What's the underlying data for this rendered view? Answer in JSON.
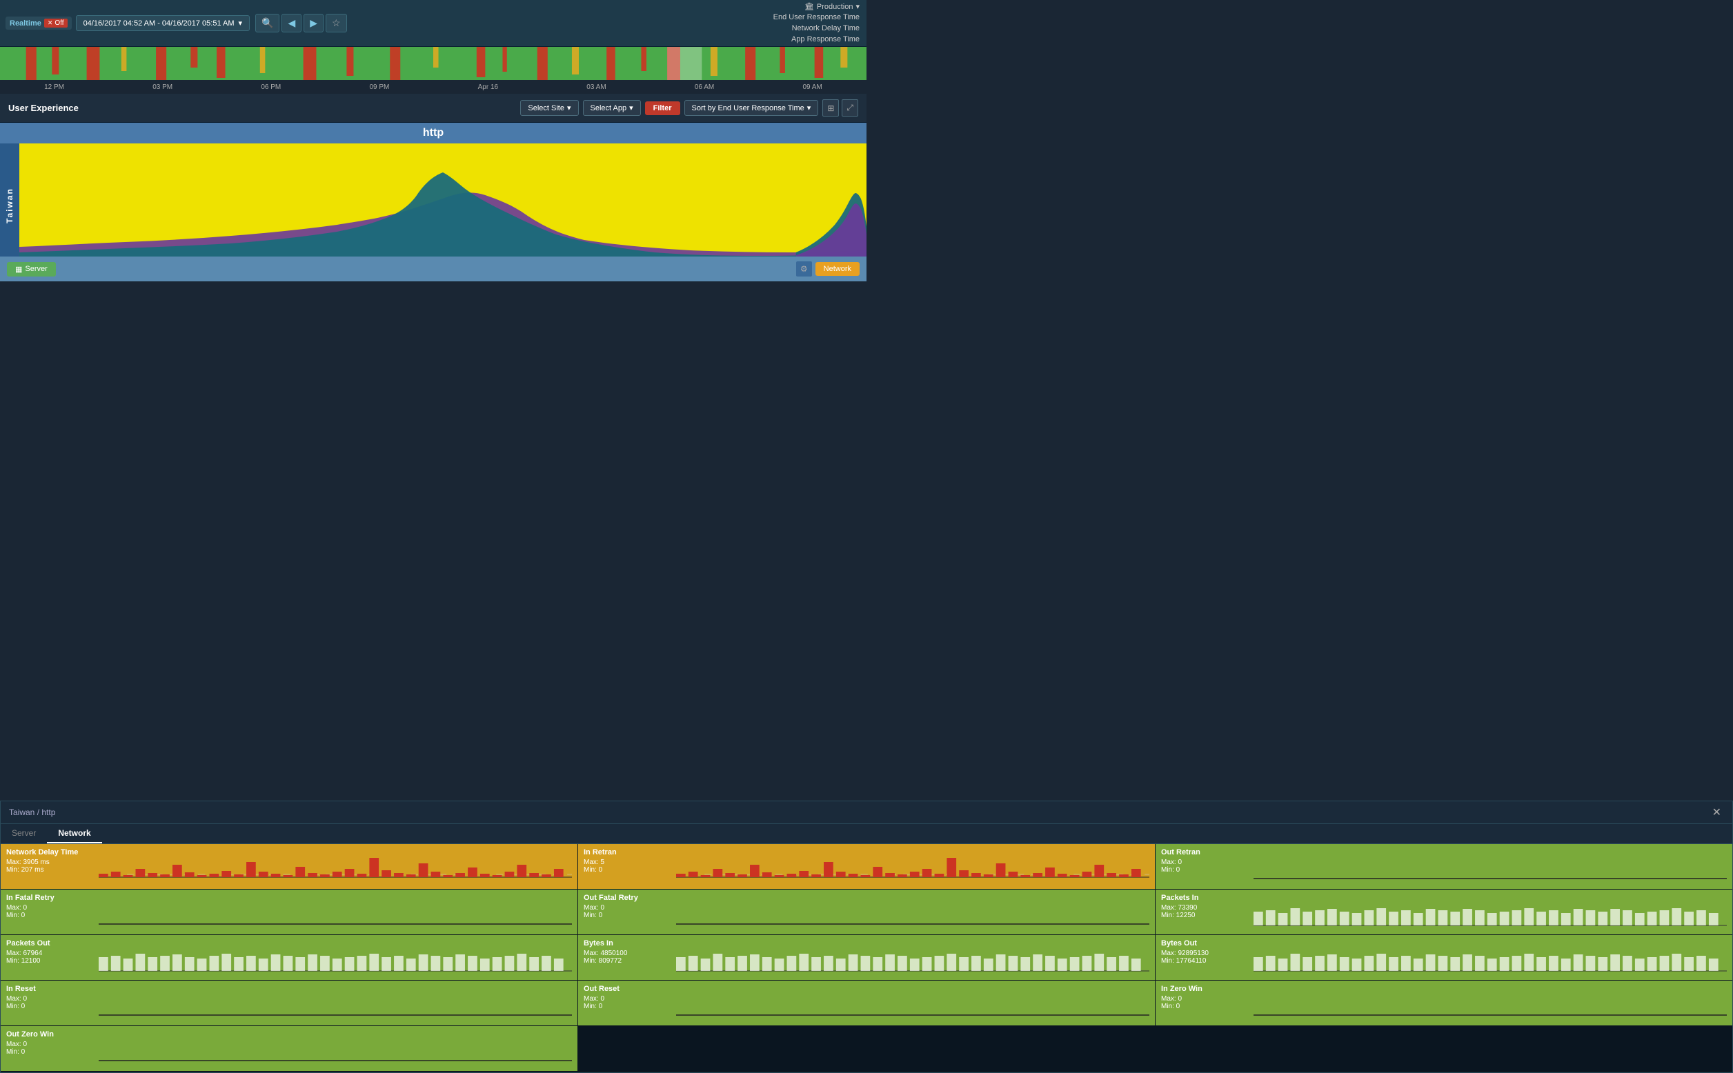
{
  "topbar": {
    "realtime_label": "Realtime",
    "off_label": "Off",
    "time_range": "04/16/2017 04:52 AM - 04/16/2017 05:51 AM",
    "production_label": "Production",
    "legend": {
      "end_user_response_time": "End User Response Time",
      "network_delay_time": "Network Delay Time",
      "app_response_time": "App Response Time"
    }
  },
  "time_labels": [
    "12 PM",
    "03 PM",
    "06 PM",
    "09 PM",
    "Apr 16",
    "03 AM",
    "06 AM",
    "09 AM"
  ],
  "ux": {
    "title": "User Experience",
    "select_site_label": "Select Site",
    "select_app_label": "Select App",
    "filter_label": "Filter",
    "sort_label": "Sort by End User Response Time"
  },
  "chart": {
    "title": "http",
    "site_label": "Taiwan"
  },
  "server_btn_label": "Server",
  "network_btn_label": "Network",
  "detail": {
    "title": "Taiwan / http",
    "tabs": [
      "Server",
      "Network"
    ],
    "active_tab": "Network",
    "metrics": [
      {
        "name": "Network Delay Time",
        "max": "Max: 3905 ms",
        "min": "Min: 207 ms",
        "style": "yellow",
        "has_chart": true,
        "chart_type": "bar_red"
      },
      {
        "name": "In Retran",
        "max": "Max: 5",
        "min": "Min: 0",
        "style": "yellow",
        "has_chart": true,
        "chart_type": "bar_red"
      },
      {
        "name": "Out Retran",
        "max": "Max: 0",
        "min": "Min: 0",
        "style": "green",
        "has_chart": false
      },
      {
        "name": "In Fatal Retry",
        "max": "Max: 0",
        "min": "Min: 0",
        "style": "green",
        "has_chart": false
      },
      {
        "name": "Out Fatal Retry",
        "max": "Max: 0",
        "min": "Min: 0",
        "style": "green",
        "has_chart": false
      },
      {
        "name": "Packets In",
        "max": "Max: 73390",
        "min": "Min: 12250",
        "style": "green",
        "has_chart": true,
        "chart_type": "bar_white"
      },
      {
        "name": "Packets Out",
        "max": "Max: 67964",
        "min": "Min: 12100",
        "style": "green",
        "has_chart": true,
        "chart_type": "bar_white"
      },
      {
        "name": "Bytes In",
        "max": "Max: 4850100",
        "min": "Min: 809772",
        "style": "green",
        "has_chart": true,
        "chart_type": "bar_white"
      },
      {
        "name": "Bytes Out",
        "max": "Max: 92895130",
        "min": "Min: 17764110",
        "style": "green",
        "has_chart": true,
        "chart_type": "bar_white"
      },
      {
        "name": "In Reset",
        "max": "Max: 0",
        "min": "Min: 0",
        "style": "green",
        "has_chart": false
      },
      {
        "name": "Out Reset",
        "max": "Max: 0",
        "min": "Min: 0",
        "style": "green",
        "has_chart": false
      },
      {
        "name": "In Zero Win",
        "max": "Max: 0",
        "min": "Min: 0",
        "style": "green",
        "has_chart": false
      },
      {
        "name": "Out Zero Win",
        "max": "Max: 0",
        "min": "Min: 0",
        "style": "green",
        "has_chart": false
      }
    ]
  }
}
